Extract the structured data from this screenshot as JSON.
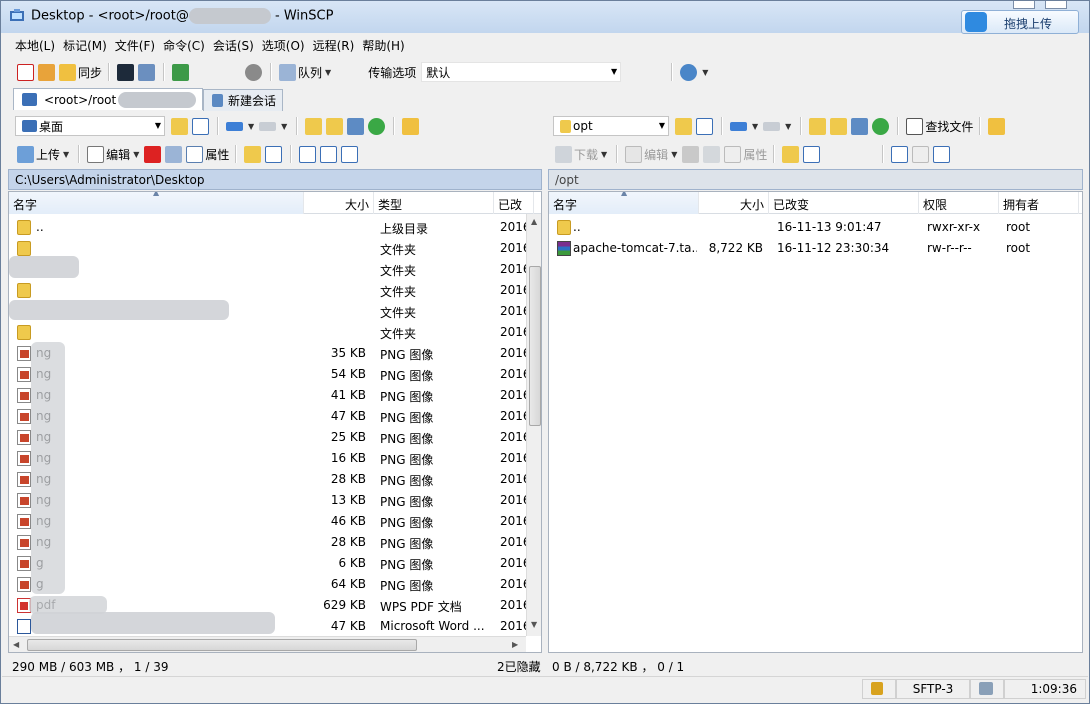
{
  "window": {
    "title_prefix": "Desktop - <root>/root@",
    "title_suffix": " - WinSCP",
    "upload_button": "拖拽上传"
  },
  "menu": [
    "本地(L)",
    "标记(M)",
    "文件(F)",
    "命令(C)",
    "会话(S)",
    "选项(O)",
    "远程(R)",
    "帮助(H)"
  ],
  "toolbar": {
    "sync_label": "同步",
    "queue_label": "队列",
    "transfer_options_label": "传输选项",
    "transfer_preset": "默认"
  },
  "tabs": {
    "session": "<root>/root",
    "new_session": "新建会话"
  },
  "local": {
    "location": "桌面",
    "upload_label": "上传",
    "edit_label": "编辑",
    "properties_label": "属性",
    "path": "C:\\Users\\Administrator\\Desktop",
    "columns": [
      "名字",
      "大小",
      "类型",
      "已改"
    ],
    "rows": [
      {
        "icon": "parent",
        "name": "..",
        "size": "",
        "type": "上级目录",
        "changed": "2016"
      },
      {
        "icon": "folder",
        "name": "",
        "size": "",
        "type": "文件夹",
        "changed": "2016"
      },
      {
        "icon": "none",
        "name": "",
        "size": "",
        "type": "文件夹",
        "changed": "2016"
      },
      {
        "icon": "folder",
        "name": "",
        "size": "",
        "type": "文件夹",
        "changed": "2016"
      },
      {
        "icon": "none",
        "name": "",
        "size": "",
        "type": "文件夹",
        "changed": "2016"
      },
      {
        "icon": "folder",
        "name": "",
        "size": "",
        "type": "文件夹",
        "changed": "2016"
      },
      {
        "icon": "png",
        "name": "ng",
        "size": "35 KB",
        "type": "PNG 图像",
        "changed": "2016"
      },
      {
        "icon": "png",
        "name": "ng",
        "size": "54 KB",
        "type": "PNG 图像",
        "changed": "2016"
      },
      {
        "icon": "png",
        "name": "ng",
        "size": "41 KB",
        "type": "PNG 图像",
        "changed": "2016"
      },
      {
        "icon": "png",
        "name": "ng",
        "size": "47 KB",
        "type": "PNG 图像",
        "changed": "2016"
      },
      {
        "icon": "png",
        "name": "ng",
        "size": "25 KB",
        "type": "PNG 图像",
        "changed": "2016"
      },
      {
        "icon": "png",
        "name": "ng",
        "size": "16 KB",
        "type": "PNG 图像",
        "changed": "2016"
      },
      {
        "icon": "png",
        "name": "ng",
        "size": "28 KB",
        "type": "PNG 图像",
        "changed": "2016"
      },
      {
        "icon": "png",
        "name": "ng",
        "size": "13 KB",
        "type": "PNG 图像",
        "changed": "2016"
      },
      {
        "icon": "png",
        "name": "ng",
        "size": "46 KB",
        "type": "PNG 图像",
        "changed": "2016"
      },
      {
        "icon": "png",
        "name": "ng",
        "size": "28 KB",
        "type": "PNG 图像",
        "changed": "2016"
      },
      {
        "icon": "png",
        "name": "g",
        "size": "6 KB",
        "type": "PNG 图像",
        "changed": "2016"
      },
      {
        "icon": "png",
        "name": "g",
        "size": "64 KB",
        "type": "PNG 图像",
        "changed": "2016"
      },
      {
        "icon": "pdf",
        "name": "pdf",
        "size": "629 KB",
        "type": "WPS PDF 文档",
        "changed": "2016"
      },
      {
        "icon": "doc",
        "name": "",
        "size": "47 KB",
        "type": "Microsoft Word ...",
        "changed": "2016"
      }
    ],
    "status": "290 MB / 603 MB ， 1 / 39",
    "hidden": "2已隐藏"
  },
  "remote": {
    "location": "opt",
    "download_label": "下载",
    "edit_label": "编辑",
    "properties_label": "属性",
    "find_files_label": "查找文件",
    "path": "/opt",
    "columns": [
      "名字",
      "大小",
      "已改变",
      "权限",
      "拥有者"
    ],
    "rows": [
      {
        "icon": "parent",
        "name": "..",
        "size": "",
        "changed": "16-11-13 9:01:47",
        "rights": "rwxr-xr-x",
        "owner": "root"
      },
      {
        "icon": "rar",
        "name": "apache-tomcat-7.ta...",
        "size": "8,722 KB",
        "changed": "16-11-12 23:30:34",
        "rights": "rw-r--r--",
        "owner": "root"
      }
    ],
    "status": "0 B / 8,722 KB ， 0 / 1"
  },
  "statusbar": {
    "protocol": "SFTP-3",
    "elapsed": "1:09:36"
  }
}
